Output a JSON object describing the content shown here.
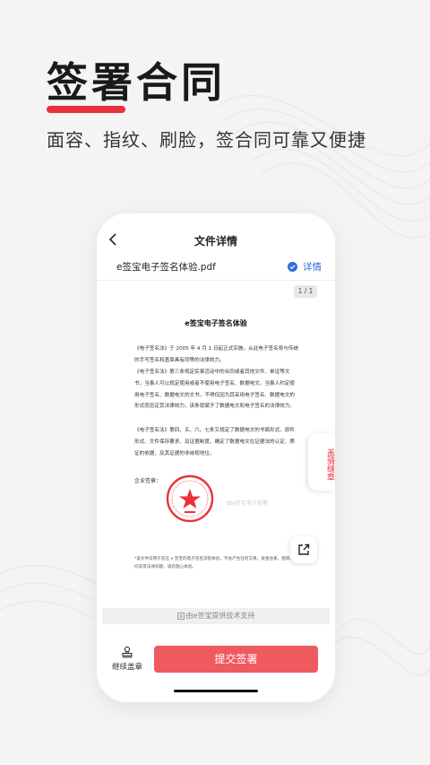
{
  "promo": {
    "headline": "签署合同",
    "subtitle": "面容、指纹、刷脸，签合同可靠又便捷",
    "accent_color": "#e8313b"
  },
  "nav": {
    "back_icon": "chevron-left-icon",
    "title": "文件详情"
  },
  "file": {
    "name": "e签宝电子签名体验.pdf",
    "verified_icon": "verified-check-icon",
    "detail_label": "详情"
  },
  "document": {
    "page_indicator": "1 / 1",
    "title": "e签宝电子签名体验",
    "paragraphs": [
      "《电子签名法》于 2005 年 4 月 1 日起正式实施。从此电子签名将与传统的手写签名和盖章具有同等的法律效力。",
      "《电子签名法》第三条规定民事活动中的合同或者其他文件、单证等文书，当事人可以规定使用或者不使用电子签名、数据电文。当事人约定使用电子签名、数据电文的文书，不得仅因为其采用电子签名、数据电文的形式而否定其法律效力。该条就赋予了数据电文和电子签名的法律效力。",
      "《电子签名法》第四、五、六、七条又规定了数据电文的书面形式、原件形式、文件保存要求、及证据制度，确定了数据电文在证据法的认定、质证的依据、及其证据的非歧视地位。"
    ],
    "signature_label": "企业签章：",
    "watermark": "由e签宝电子签署",
    "disclaimer": "*该文件仅用于您在 e 签宝的电子签名流程体验，不会产生任何交易，资金往来，担保，委托等等法律问题，请您放心体验。"
  },
  "side_tab": {
    "label": "盖骑缝章"
  },
  "share_icon": "external-share-icon",
  "powered_by": "由e签宝提供技术支持",
  "bottom": {
    "continue_label": "继续盖章",
    "continue_icon": "stamp-icon",
    "submit_label": "提交签署",
    "submit_color": "#ef5a5f"
  }
}
